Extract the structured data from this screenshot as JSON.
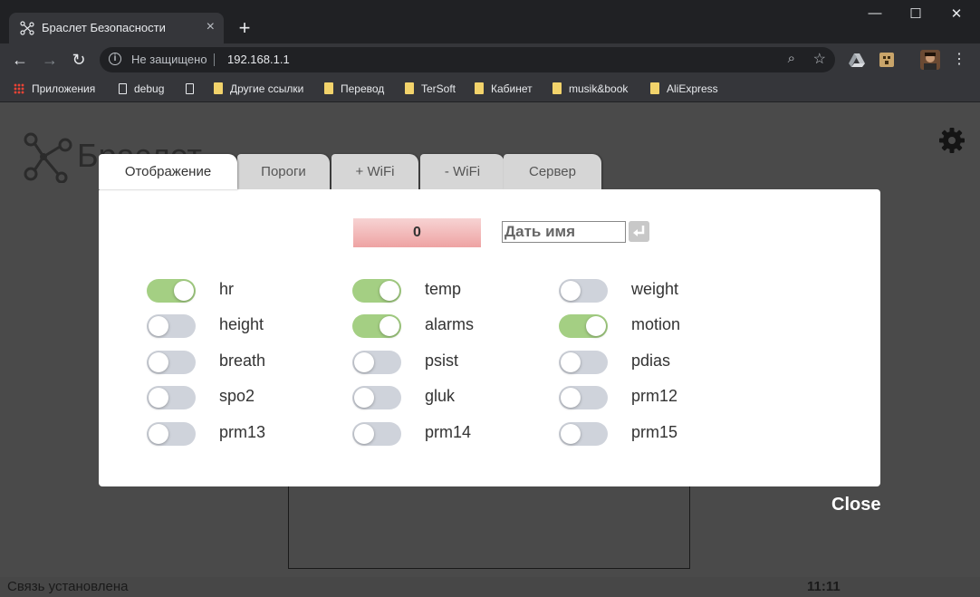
{
  "browser": {
    "tab_title": "Браслет Безопасности",
    "tab_close": "×",
    "new_tab": "+",
    "win_min": "—",
    "win_max": "☐",
    "win_close": "✕",
    "security_label": "Не защищено",
    "url": "192.168.1.1",
    "bookmarks": [
      {
        "label": "Приложения",
        "icon": "apps-icon"
      },
      {
        "label": "debug",
        "icon": "page-icon"
      },
      {
        "label": "",
        "icon": "page-icon"
      },
      {
        "label": "Другие ссылки",
        "icon": "folder-icon"
      },
      {
        "label": "Перевод",
        "icon": "folder-icon"
      },
      {
        "label": "TerSoft",
        "icon": "folder-icon"
      },
      {
        "label": "Кабинет",
        "icon": "folder-icon"
      },
      {
        "label": "musik&book",
        "icon": "folder-icon"
      },
      {
        "label": "AliExpress",
        "icon": "folder-icon"
      }
    ]
  },
  "page": {
    "logo_text": "Браслет",
    "status_text": "Связь установлена",
    "clock": "11:11"
  },
  "modal": {
    "tabs": [
      "Отображение",
      "Пороги",
      "+ WiFi",
      "- WiFi",
      "Сервер"
    ],
    "active_tab": "Отображение",
    "counter_value": "0",
    "name_placeholder": "Дать имя",
    "enter_symbol": "↲",
    "switches": [
      {
        "label": "hr",
        "on": true
      },
      {
        "label": "temp",
        "on": true
      },
      {
        "label": "weight",
        "on": false
      },
      {
        "label": "height",
        "on": false
      },
      {
        "label": "alarms",
        "on": true
      },
      {
        "label": "motion",
        "on": true
      },
      {
        "label": "breath",
        "on": false
      },
      {
        "label": "psist",
        "on": false
      },
      {
        "label": "pdias",
        "on": false
      },
      {
        "label": "spo2",
        "on": false
      },
      {
        "label": "gluk",
        "on": false
      },
      {
        "label": "prm12",
        "on": false
      },
      {
        "label": "prm13",
        "on": false
      },
      {
        "label": "prm14",
        "on": false
      },
      {
        "label": "prm15",
        "on": false
      }
    ],
    "close_label": "Close"
  },
  "colors": {
    "switch_on": "#a4cf83",
    "switch_off": "#cfd3db",
    "counter_bg": "#eea3a3"
  }
}
